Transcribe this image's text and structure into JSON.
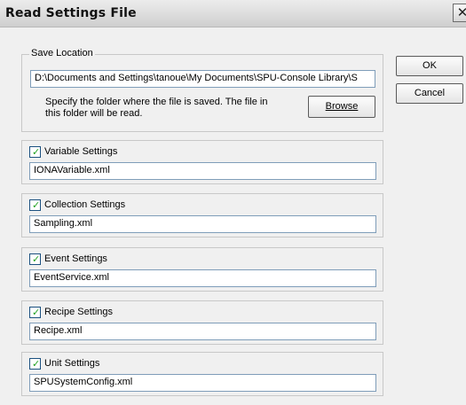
{
  "window": {
    "title": "Read Settings File",
    "close_glyph": "✕"
  },
  "save_location": {
    "legend": "Save Location",
    "path": "D:\\Documents and Settings\\tanoue\\My Documents\\SPU-Console Library\\S",
    "description": "Specify the folder where the file is saved. The file in this folder will be read.",
    "browse_label": "Browse"
  },
  "buttons": {
    "ok_label": "OK",
    "cancel_label": "Cancel"
  },
  "settings": [
    {
      "label": "Variable Settings",
      "checked": true,
      "file": "IONAVariable.xml"
    },
    {
      "label": "Collection Settings",
      "checked": true,
      "file": "Sampling.xml"
    },
    {
      "label": "Event Settings",
      "checked": true,
      "file": "EventService.xml"
    },
    {
      "label": "Recipe Settings",
      "checked": true,
      "file": "Recipe.xml"
    },
    {
      "label": "Unit Settings",
      "checked": true,
      "file": "SPUSystemConfig.xml"
    }
  ]
}
